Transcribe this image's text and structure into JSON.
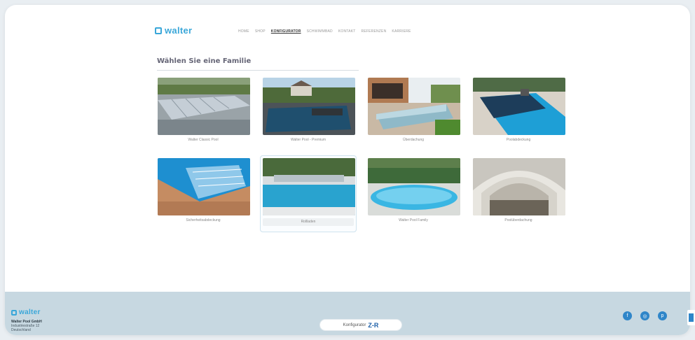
{
  "header": {
    "logo_text": "walter",
    "nav": [
      {
        "label": "Home",
        "active": false
      },
      {
        "label": "Shop",
        "active": false
      },
      {
        "label": "Konfigurator",
        "active": true
      },
      {
        "label": "Schwimmbad",
        "active": false
      },
      {
        "label": "Kontakt",
        "active": false
      },
      {
        "label": "Referenzen",
        "active": false
      },
      {
        "label": "Karriere",
        "active": false
      }
    ]
  },
  "main": {
    "title": "Wählen Sie eine Familie",
    "families": [
      {
        "label": "Walter Classic Pool",
        "selected": false
      },
      {
        "label": "Walter Pool - Premium",
        "selected": false
      },
      {
        "label": "Überdachung",
        "selected": false
      },
      {
        "label": "Poolabdeckung",
        "selected": false
      },
      {
        "label": "Sicherheitsabdeckung",
        "selected": false
      },
      {
        "label": "Rollladen",
        "selected": true
      },
      {
        "label": "Walter Pool Family",
        "selected": false
      },
      {
        "label": "Poolüberdachung",
        "selected": false
      }
    ]
  },
  "footer": {
    "logo_text": "walter",
    "company_name": "Walter Pool GmbH",
    "company_line1": "Industriestraße 12",
    "company_line2": "Deutschland",
    "button_text": "Konfigurator",
    "button_mark": "Z-R",
    "socials": [
      "facebook-icon",
      "instagram-icon",
      "pinterest-icon"
    ]
  },
  "colors": {
    "brand": "#3aa7d9",
    "footer_bg": "#c7d8e1",
    "page_bg": "#e9eef2"
  }
}
